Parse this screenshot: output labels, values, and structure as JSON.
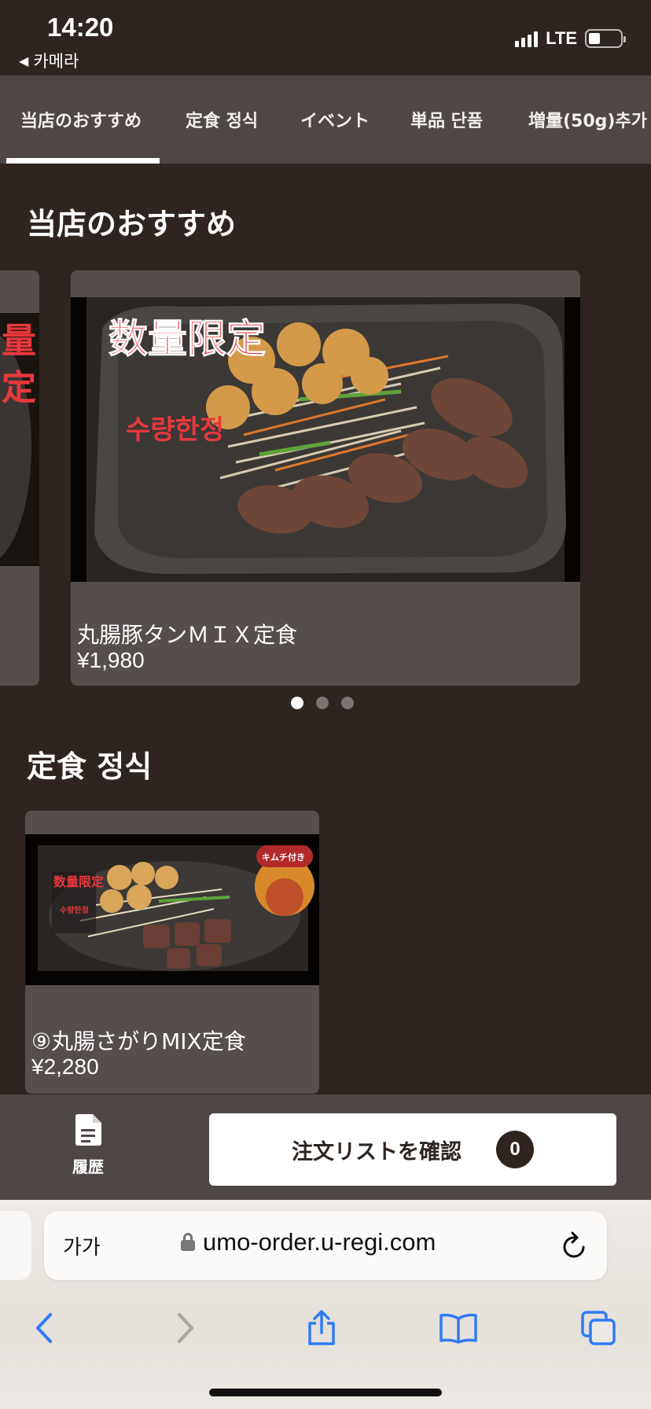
{
  "status_bar": {
    "time": "14:20",
    "back_label": "카메라",
    "network": "LTE"
  },
  "tabs": [
    {
      "label": "当店のおすすめ",
      "active": true
    },
    {
      "label": "定食 정식",
      "active": false
    },
    {
      "label": "イベント",
      "active": false
    },
    {
      "label": "単品 단품",
      "active": false
    },
    {
      "label": "増量(50g)추가",
      "active": false
    }
  ],
  "recommended": {
    "title": "当店のおすすめ",
    "featured": {
      "name": "丸腸豚タンＭＩＸ定食",
      "price": "¥1,980",
      "image_text_ja": "数量限定",
      "image_text_ko": "수량한정"
    },
    "carousel_pages": 3,
    "active_page": 1
  },
  "set_meal": {
    "title": "定食 정식",
    "items": [
      {
        "name": "⑨丸腸さがりMIX定食",
        "price": "¥2,280",
        "image_badge": "キムチ付き",
        "image_text_ja": "数量限定",
        "image_text_ko": "수량한정"
      }
    ]
  },
  "action_bar": {
    "history_label": "履歴",
    "order_button_label": "注文リストを確認",
    "order_count": "0"
  },
  "browser": {
    "aa_label": "가가",
    "url": "umo-order.u-regi.com"
  },
  "colors": {
    "background": "#2e2520",
    "panel": "#4f4746",
    "card": "#564e4d",
    "accent_red": "#e8383d",
    "ios_blue": "#2f7bf5"
  }
}
